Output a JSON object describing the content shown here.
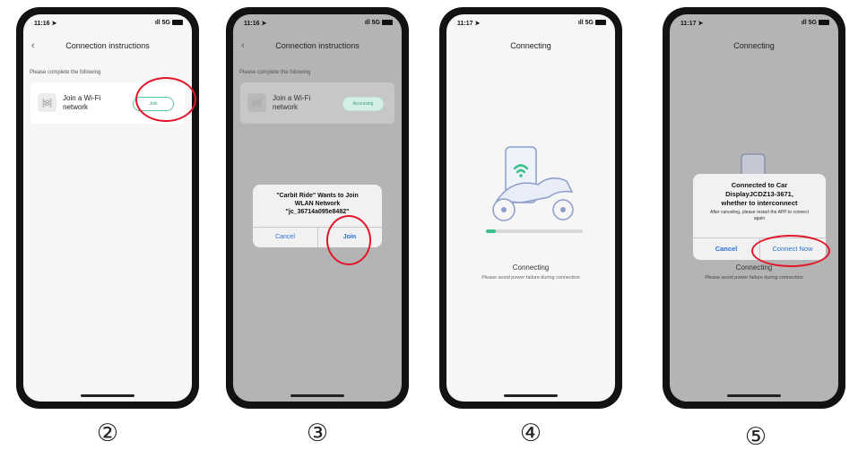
{
  "step2": {
    "time": "11:16",
    "network": "5G",
    "title": "Connection instructions",
    "hint": "Please complete the following",
    "card_text": "Join a Wi-Fi network",
    "join_pill": "Join",
    "step_number": "②"
  },
  "step3": {
    "time": "11:16",
    "network": "5G",
    "title": "Connection instructions",
    "hint": "Please complete the following",
    "card_text": "Join a Wi-Fi network",
    "status_pill": "Accessing",
    "dialog_line1": "\"Carbit Ride\" Wants to Join",
    "dialog_line2": "WLAN Network",
    "dialog_line3": "\"jc_36714a095e8482\"",
    "cancel": "Cancel",
    "join": "Join",
    "step_number": "③"
  },
  "step4": {
    "time": "11:17",
    "network": "5G",
    "title": "Connecting",
    "progress": 0.1,
    "status_label": "Connecting",
    "sub_label": "Please avoid power failure during connection",
    "step_number": "④"
  },
  "step5": {
    "time": "11:17",
    "network": "5G",
    "title": "Connecting",
    "dialog_line1": "Connected to Car",
    "dialog_line2": "DisplayJCDZ13-3671,",
    "dialog_line3": "whether to interconnect",
    "dialog_note": "After canceling, please restart the APP to connect again",
    "cancel": "Cancel",
    "connect_now": "Connect Now",
    "status_label": "Connecting",
    "sub_label": "Please avoid power failure during connection",
    "step_number": "⑤"
  },
  "colors": {
    "accent_green": "#3cc18c",
    "ios_blue": "#2a71d0",
    "highlight_red": "#e2162a"
  },
  "icons": [
    "wifi-icon",
    "back-chevron-icon",
    "location-arrow-icon",
    "signal-icon",
    "battery-icon"
  ]
}
